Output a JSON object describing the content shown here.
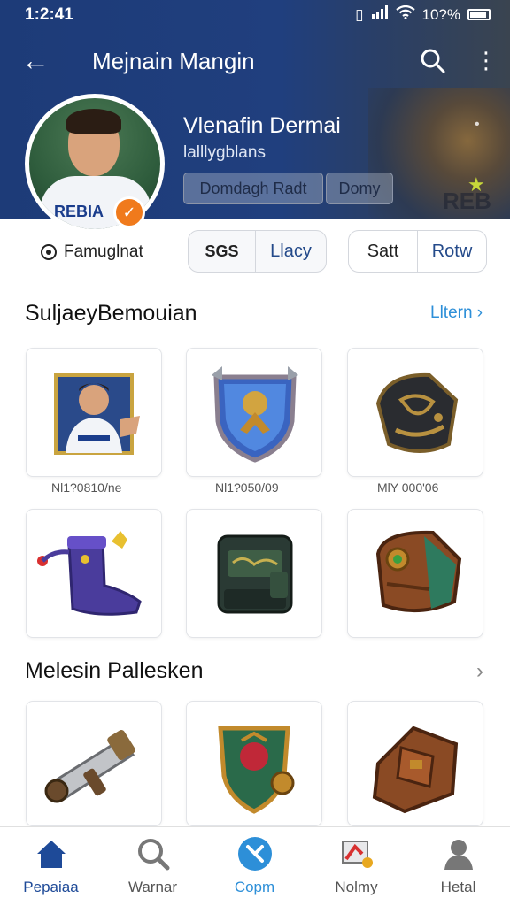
{
  "status_bar": {
    "time": "1:2:41",
    "battery": "10?%"
  },
  "app_bar": {
    "title": "Mejnain Mangin"
  },
  "profile": {
    "name": "Vlenafin Dermai",
    "subtitle": "lalllygblans",
    "jersey_text": "REBIA",
    "chips": [
      "Domdagh Radt",
      "Domy"
    ],
    "hero_text": "REB"
  },
  "actions": {
    "follow_label": "Famuglnat",
    "segment1": [
      "SGS",
      "Llacy"
    ],
    "segment2": [
      "Satt",
      "Rotw"
    ]
  },
  "sections": [
    {
      "title": "SuljaeyBemouian",
      "see_all": "Lltern",
      "items": [
        {
          "icon": "player-card-icon",
          "caption": "Nl1?0810/ne"
        },
        {
          "icon": "shield-hero-icon",
          "caption": "Nl1?050/09"
        },
        {
          "icon": "bracer-icon",
          "caption": "MlY 000'06"
        },
        {
          "icon": "boot-icon",
          "caption": ""
        },
        {
          "icon": "backpack-icon",
          "caption": ""
        },
        {
          "icon": "belt-icon",
          "caption": ""
        }
      ]
    },
    {
      "title": "Melesin Pallesken",
      "items": [
        {
          "icon": "cannon-icon"
        },
        {
          "icon": "emblem-shield-icon"
        },
        {
          "icon": "leather-bag-icon"
        }
      ]
    }
  ],
  "bottom_nav": [
    {
      "label": "Pepaiaa",
      "icon": "home-icon",
      "active": true
    },
    {
      "label": "Warnar",
      "icon": "search-icon",
      "active": false
    },
    {
      "label": "Copm",
      "icon": "cancel-circle-icon",
      "active": false
    },
    {
      "label": "Nolmy",
      "icon": "flag-icon",
      "active": false
    },
    {
      "label": "Hetal",
      "icon": "person-icon",
      "active": false
    }
  ],
  "colors": {
    "header_blue": "#1d3b78",
    "accent_blue": "#2d8fd8",
    "badge_orange": "#f07a1c"
  }
}
